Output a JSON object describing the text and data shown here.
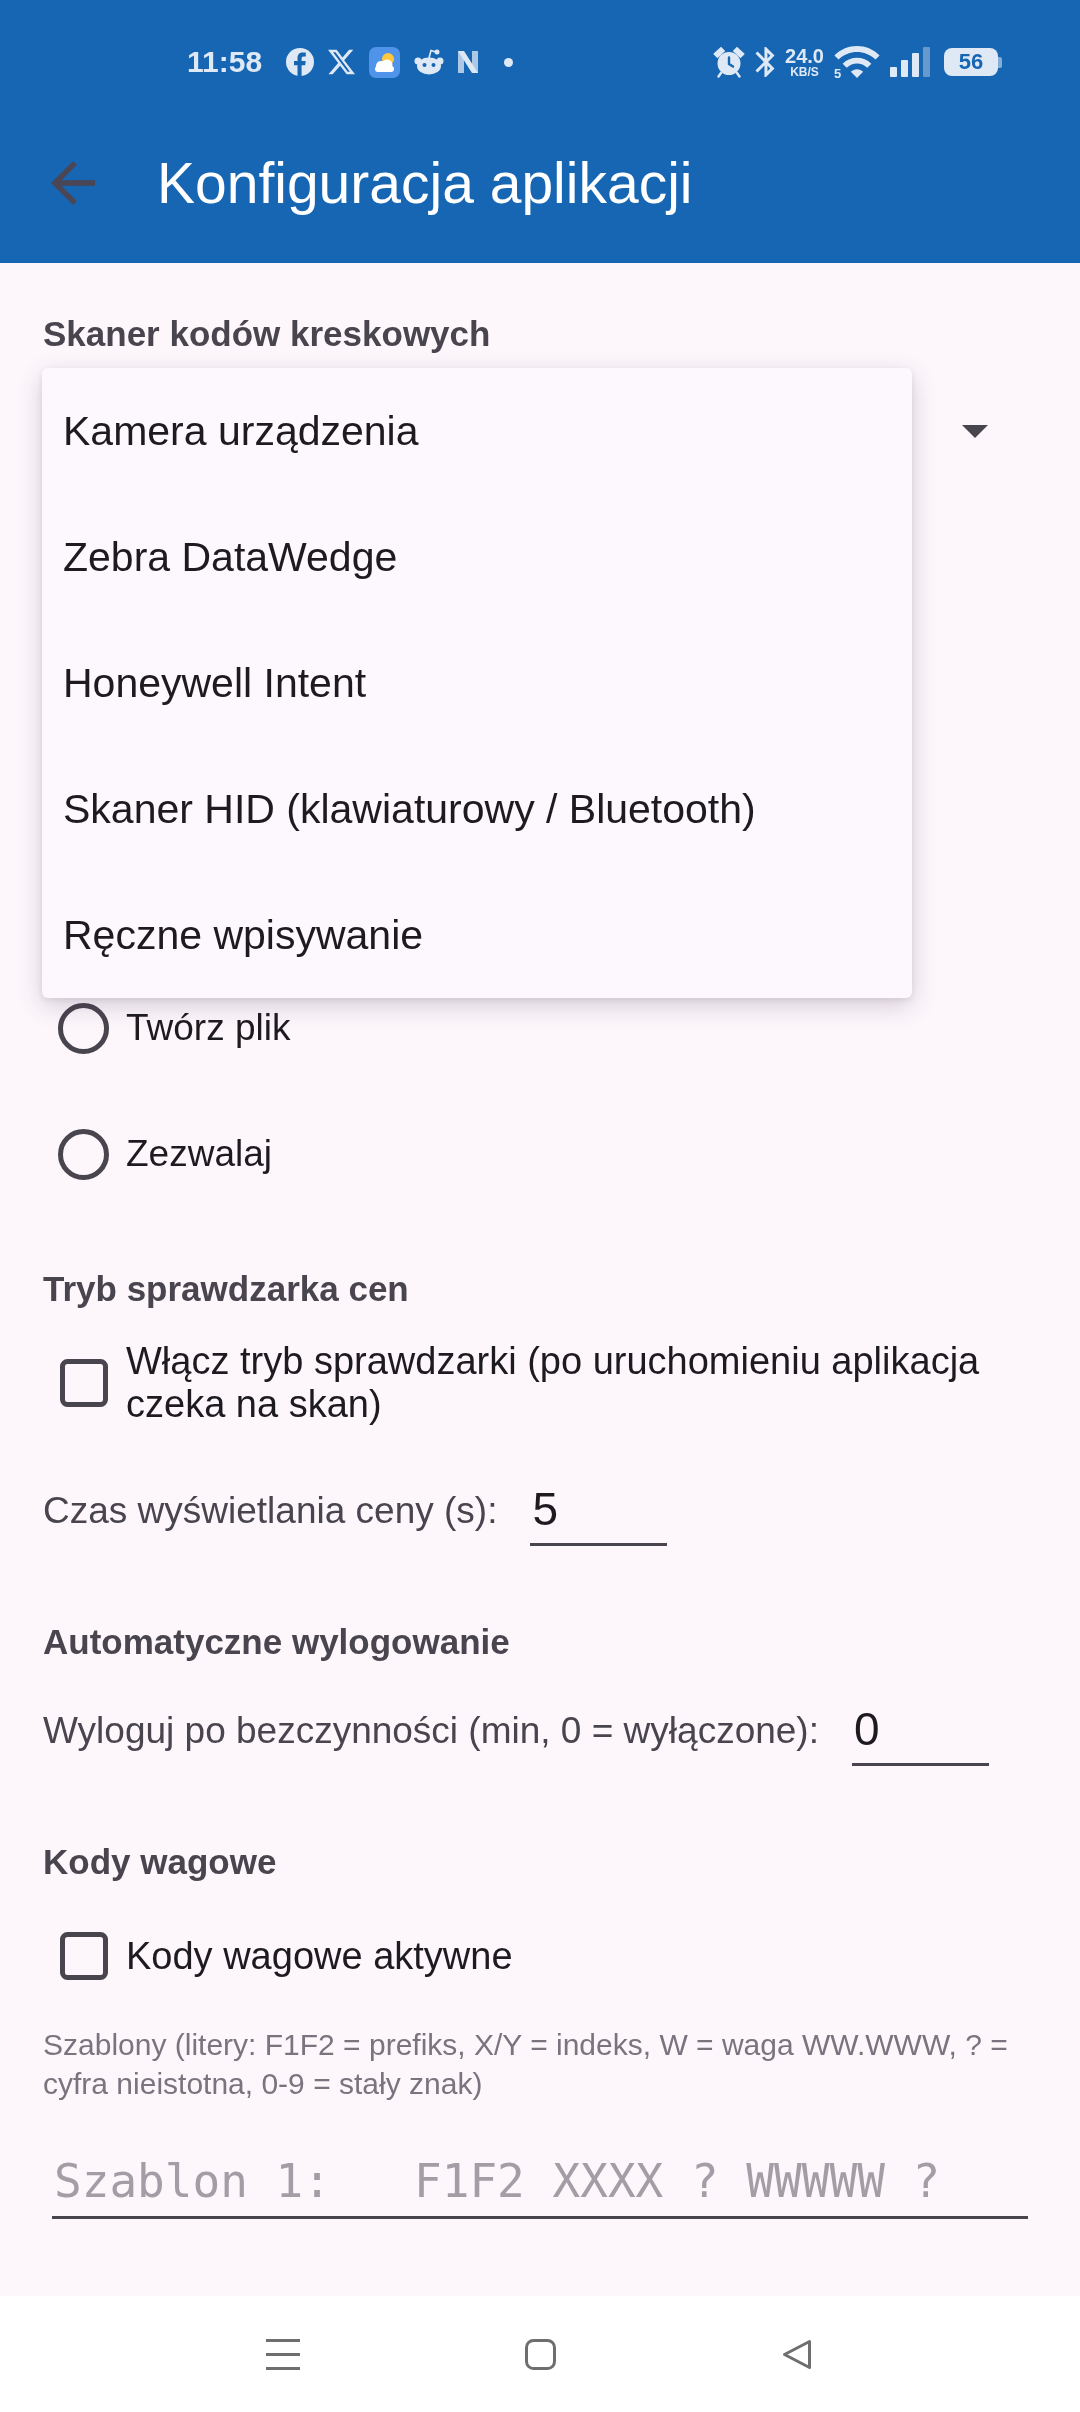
{
  "status_bar": {
    "time": "11:58",
    "network_speed": "24.0",
    "network_speed_unit": "KB/S",
    "wifi_band": "5",
    "battery": "56"
  },
  "app_bar": {
    "title": "Konfiguracja aplikacji"
  },
  "scanner": {
    "title": "Skaner kodów kreskowych",
    "dropdown": {
      "expanded": true,
      "options": [
        {
          "label": "Kamera urządzenia",
          "selected": false
        },
        {
          "label": "Zebra DataWedge",
          "selected": false
        },
        {
          "label": "Honeywell Intent",
          "selected": false
        },
        {
          "label": "Skaner HID (klawiaturowy / Bluetooth)",
          "selected": false
        },
        {
          "label": "Ręczne wpisywanie",
          "selected": false
        }
      ]
    }
  },
  "radio_options": [
    {
      "label": "Twórz plik",
      "selected": false
    },
    {
      "label": "Zezwalaj",
      "selected": false
    }
  ],
  "sections": [
    {
      "title": "Tryb sprawdzarka cen",
      "rows": [
        {
          "kind": "checkbox",
          "label": "Włącz tryb sprawdzarki (po uruchomieniu aplikacja czeka na skan)",
          "checked": false
        },
        {
          "kind": "number_field",
          "label": "Czas wyświetlania ceny (s):",
          "value": "5"
        }
      ]
    },
    {
      "title": "Automatyczne wylogowanie",
      "rows": [
        {
          "kind": "number_field",
          "label": "Wyloguj po bezczynności (min, 0 = wyłączone):",
          "value": "0"
        }
      ]
    },
    {
      "title": "Kody wagowe",
      "rows": [
        {
          "kind": "checkbox",
          "label": "Kody wagowe aktywne",
          "checked": false
        },
        {
          "kind": "hint",
          "text": "Szablony (litery: F1F2 = prefiks, X/Y = indeks, W = waga WW.WWW, ? = cyfra nieistotna, 0-9 = stały znak)"
        },
        {
          "kind": "template_field",
          "placeholder": "Szablon 1:   F1F2 XXXX ? WWWWW ?"
        }
      ]
    }
  ]
}
